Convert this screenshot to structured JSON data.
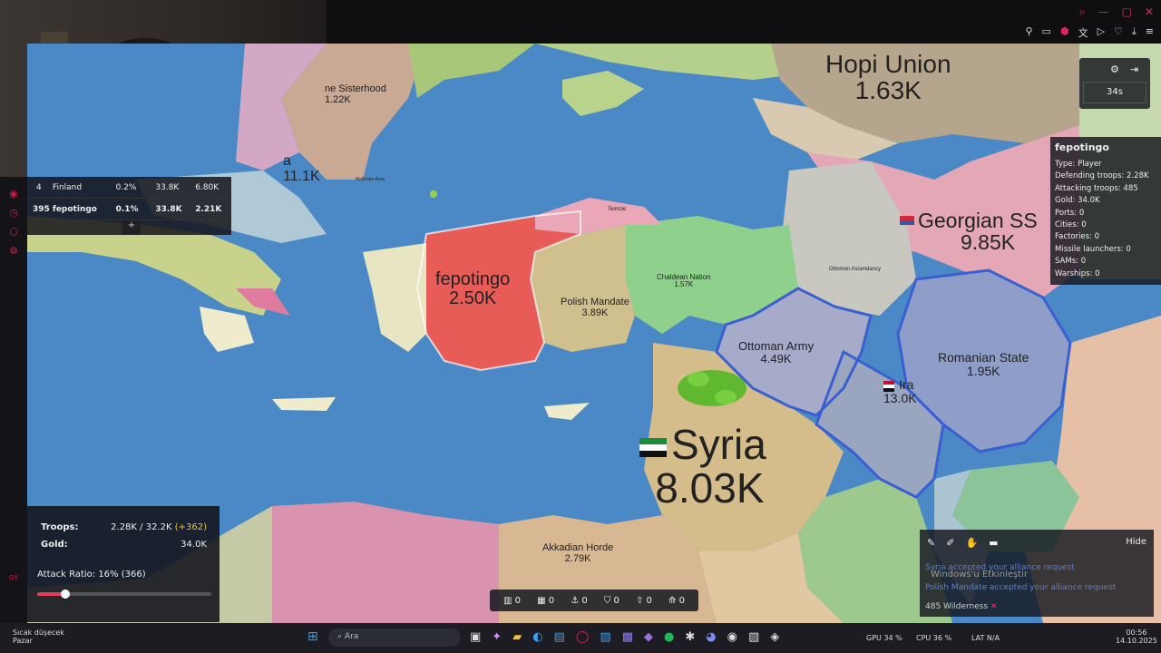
{
  "browser": {
    "window_controls": [
      "search-icon",
      "minimize-icon",
      "maximize-icon",
      "close-icon"
    ],
    "toolbar_icons": [
      "pin-icon",
      "tab-icon",
      "shield-icon",
      "translate-icon",
      "play-icon",
      "heart-icon",
      "download-icon",
      "menu-icon"
    ]
  },
  "leaderboard": {
    "rows": [
      {
        "rank": "4",
        "name": "Finland",
        "pct": "0.2%",
        "troops": "33.8K",
        "gold": "6.80K"
      },
      {
        "rank": "395",
        "name": "fepotingo",
        "pct": "0.1%",
        "troops": "33.8K",
        "gold": "2.21K"
      }
    ],
    "add_label": "+"
  },
  "map_labels": {
    "hopi_union": {
      "name": "Hopi Union",
      "value": "1.63K"
    },
    "sisterhood": {
      "name": "ne Sisterhood",
      "value": "1.22K"
    },
    "georgian": {
      "name": "Georgian SS",
      "value": "9.85K"
    },
    "fepotingo": {
      "name": "fepotingo",
      "value": "2.50K"
    },
    "polish_mandate": {
      "name": "Polish Mandate",
      "value": "3.89K"
    },
    "chaldean_nation": {
      "name": "Chaldean Nation",
      "value": "1.57K"
    },
    "ottoman_army": {
      "name": "Ottoman Army",
      "value": "4.49K"
    },
    "romanian_state": {
      "name": "Romanian State",
      "value": "1.95K"
    },
    "iraq": {
      "name": "Ira",
      "value": "13.0K"
    },
    "syria": {
      "name": "Syria",
      "value": "8.03K"
    },
    "akkadian": {
      "name": "Akkadian Horde",
      "value": "2.79K"
    },
    "left_partial": {
      "name": "a",
      "value": "11.1K"
    },
    "ottoman_ascendancy": {
      "name": "Ottoman Ascendancy",
      "value": ""
    },
    "tiny_top": {
      "name": "Teimzie",
      "value": ""
    },
    "tiny_left": {
      "name": "Mallorian Area",
      "value": ""
    }
  },
  "timer": {
    "value": "34s"
  },
  "player_info": {
    "name": "fepotingo",
    "lines": [
      "Type: Player",
      "Defending troops: 2.28K",
      "Attacking troops: 485",
      "Gold: 34.0K",
      "Ports: 0",
      "Cities: 0",
      "Factories: 0",
      "Missile launchers: 0",
      "SAMs: 0",
      "Warships: 0"
    ]
  },
  "stats": {
    "troops_label": "Troops:",
    "troops_value": "2.28K / 32.2K",
    "troops_delta": "(+362)",
    "gold_label": "Gold:",
    "gold_value": "34.0K",
    "attack_ratio": "Attack Ratio: 16% (366)",
    "attack_ratio_fraction": 0.16
  },
  "bottom_counts": [
    "0",
    "0",
    "0",
    "0",
    "0",
    "0"
  ],
  "chat": {
    "hide_label": "Hide",
    "messages": [
      "Syria accepted your alliance request",
      "Polish Mandate accepted your alliance request",
      "485 Wilderness"
    ],
    "watermark": "Windows'u Etkinleştir"
  },
  "taskbar": {
    "weather_line1": "Sıcak düşecek",
    "weather_line2": "Pazar",
    "search_placeholder": "Ara",
    "gpu": "GPU 34 %",
    "cpu": "CPU 36 %",
    "lang": "LAT N/A",
    "time": "00:56",
    "date": "14.10.2025",
    "left_badge": "GX"
  }
}
